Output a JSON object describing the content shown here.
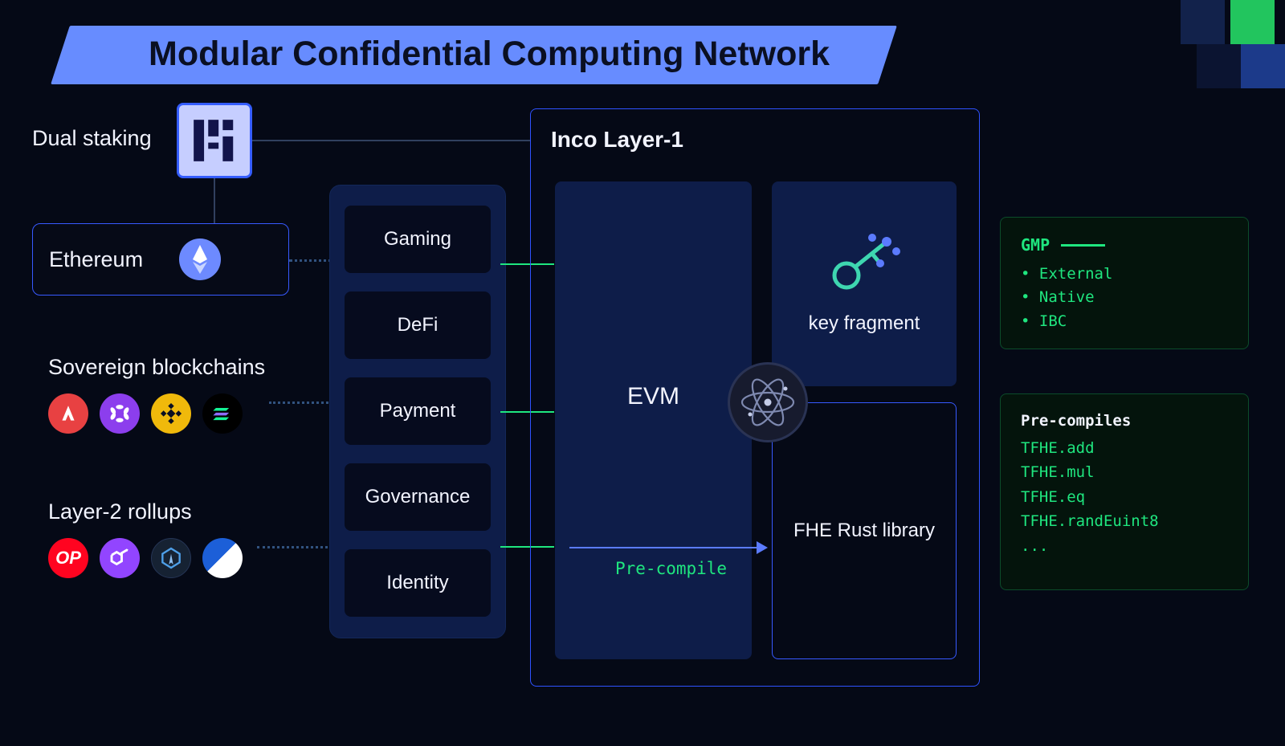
{
  "title": "Modular Confidential Computing Network",
  "dualStakingLabel": "Dual staking",
  "ethereum": {
    "label": "Ethereum"
  },
  "sovereign": {
    "label": "Sovereign blockchains",
    "chains": [
      "avalanche",
      "polygon",
      "bnb",
      "solana"
    ]
  },
  "rollups": {
    "label": "Layer-2 rollups",
    "chains": [
      "optimism",
      "polygon",
      "arbitrum",
      "base"
    ]
  },
  "apps": [
    "Gaming",
    "DeFi",
    "Payment",
    "Governance",
    "Identity"
  ],
  "inco": {
    "title": "Inco Layer-1",
    "evm": "EVM",
    "keyFragment": "key fragment",
    "fheRust": "FHE Rust library",
    "preCompileLabel": "Pre-compile"
  },
  "gmp": {
    "title": "GMP",
    "items": [
      "External",
      "Native",
      "IBC"
    ]
  },
  "preCompiles": {
    "title": "Pre-compiles",
    "items": [
      "TFHE.add",
      "TFHE.mul",
      "TFHE.eq",
      "TFHE.randEuint8",
      "..."
    ]
  }
}
